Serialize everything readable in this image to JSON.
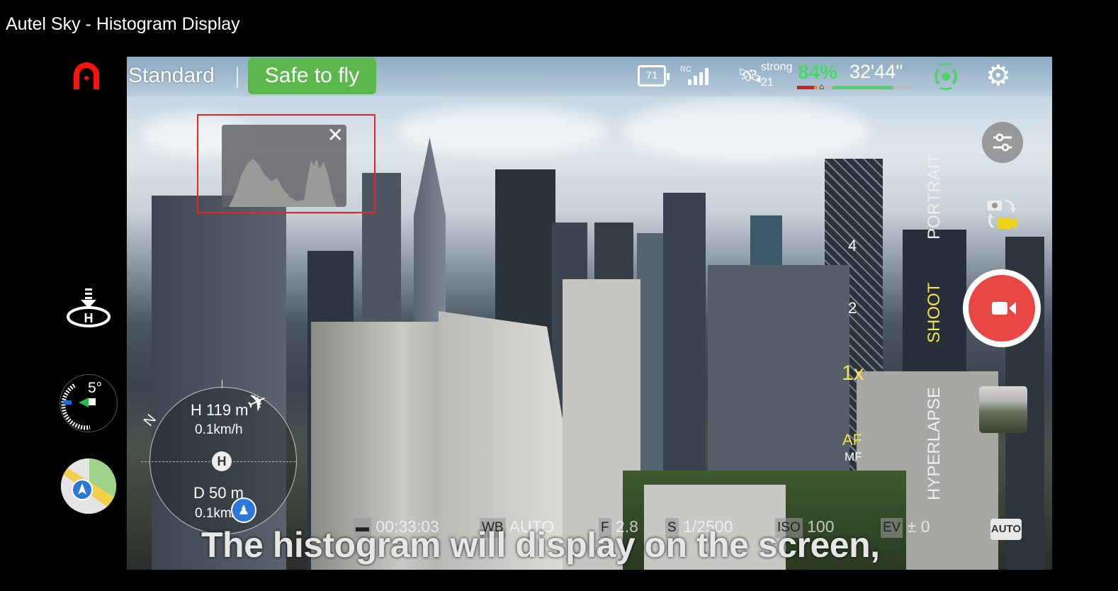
{
  "page": {
    "title": "Autel Sky - Histogram Display"
  },
  "left_rail": {
    "logo_icon": "autel-logo-icon",
    "land_icon": "auto-land-icon",
    "gimbal": {
      "pitch_label": "5°"
    },
    "map_icon": "mini-map-icon"
  },
  "topbar": {
    "flight_mode": "Standard",
    "status_badge": "Safe to fly",
    "battery_level": "71",
    "rc_label": "RC",
    "gps_strength": "strong",
    "gps_satellites": "21",
    "battery_percent": "84%",
    "flight_time_remaining": "32'44''",
    "battery_bar": {
      "critical_fraction": 0.15,
      "low_fraction": 0.03,
      "remaining_fraction": 0.84
    },
    "colors": {
      "safe": "#5cb84d",
      "battery_green": "#4fd36a",
      "battery_red": "#c8241f",
      "battery_orange": "#e38b2a"
    }
  },
  "histogram": {
    "close_label": "✕",
    "highlight_color": "#e22222"
  },
  "radar": {
    "north_label": "N",
    "height": "H 119 m",
    "vertical_speed": "0.1km/h",
    "home_label": "H",
    "distance": "D 50 m",
    "horizontal_speed": "0.1km/h"
  },
  "zoom": {
    "levels": [
      "4",
      "2"
    ],
    "current": "1x",
    "focus_mode": "AF",
    "focus_alt": "MF"
  },
  "shoot_modes": {
    "items": [
      "PORTRAIT",
      "SHOOT",
      "HYPERLAPSE"
    ],
    "active": "SHOOT",
    "active_color": "#f4e24a"
  },
  "camera_params": {
    "storage_time": "00:33:03",
    "wb_label": "WB",
    "wb_value": "AUTO",
    "f_label": "F",
    "f_value": "2.8",
    "s_label": "S",
    "s_value": "1/2500",
    "iso_label": "ISO",
    "iso_value": "100",
    "ev_label": "EV",
    "ev_value": "± 0",
    "exposure_mode": "AUTO"
  },
  "record_button": {
    "color": "#e84545"
  },
  "subtitle": "The histogram will display on the screen,"
}
